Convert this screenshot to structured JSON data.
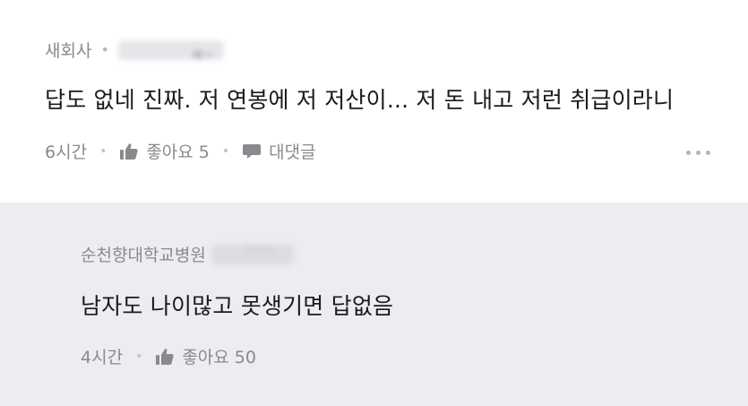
{
  "comment": {
    "author": "새회사",
    "author_trailing": "서ㅡ",
    "text": "답도 없네 진짜. 저 연봉에 저 저산이... 저 돈 내고 저런 취급이라니",
    "time": "6시간",
    "like_label": "좋아요 5",
    "reply_label": "대댓글"
  },
  "reply": {
    "author": "순천향대학교병원",
    "author_trailing": "······",
    "text": "남자도 나이많고 못생기면 답없음",
    "time": "4시간",
    "like_label": "좋아요 50"
  },
  "icons": {
    "like": "thumbs-up-icon",
    "reply": "speech-bubble-icon",
    "more": "more-dots-icon"
  },
  "colors": {
    "reply_background": "#ececf1",
    "meta_text": "#8a8a8e",
    "body_text": "#1b1b1d"
  }
}
